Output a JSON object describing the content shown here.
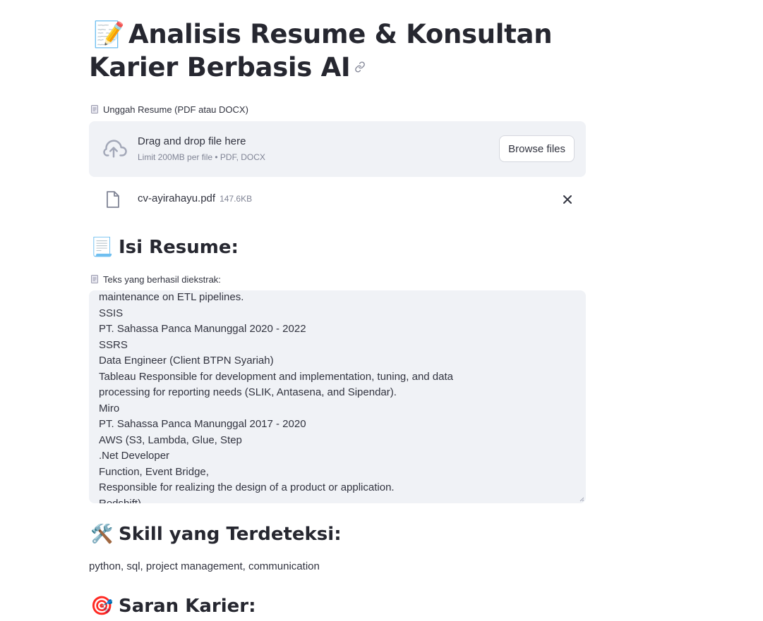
{
  "header": {
    "title_emoji": "📝",
    "title": "Analisis Resume & Konsultan Karier Berbasis AI"
  },
  "uploader": {
    "label": "Unggah Resume (PDF atau DOCX)",
    "drag_text": "Drag and drop file here",
    "limit_text": "Limit 200MB per file • PDF, DOCX",
    "browse_label": "Browse files",
    "file": {
      "name": "cv-ayirahayu.pdf",
      "size": "147.6KB"
    }
  },
  "resume_section": {
    "emoji": "📃",
    "heading": "Isi Resume:",
    "textarea_label": "Teks yang berhasil diekstrak:",
    "lines": [
      "maintenance on ETL pipelines.",
      "SSIS",
      "PT. Sahassa Panca Manunggal 2020 - 2022",
      "SSRS",
      "Data Engineer (Client BTPN Syariah)",
      "Tableau Responsible for development and implementation, tuning, and data",
      "processing for reporting needs (SLIK, Antasena, and Sipendar).",
      "Miro",
      "PT. Sahassa Panca Manunggal 2017 - 2020",
      "AWS (S3, Lambda, Glue, Step",
      ".Net Developer",
      "Function, Event Bridge,",
      "Responsible for realizing the design of a product or application.",
      "Redshift)"
    ]
  },
  "skills_section": {
    "emoji": "🛠️",
    "heading": "Skill yang Terdeteksi:",
    "text": "python, sql, project management, communication"
  },
  "career_section": {
    "emoji": "🎯",
    "heading": "Saran Karier:"
  },
  "colors": {
    "text": "#31333f",
    "heading": "#262730",
    "muted": "#808495",
    "panel": "#f0f2f6",
    "icon": "#a3a8b8"
  }
}
